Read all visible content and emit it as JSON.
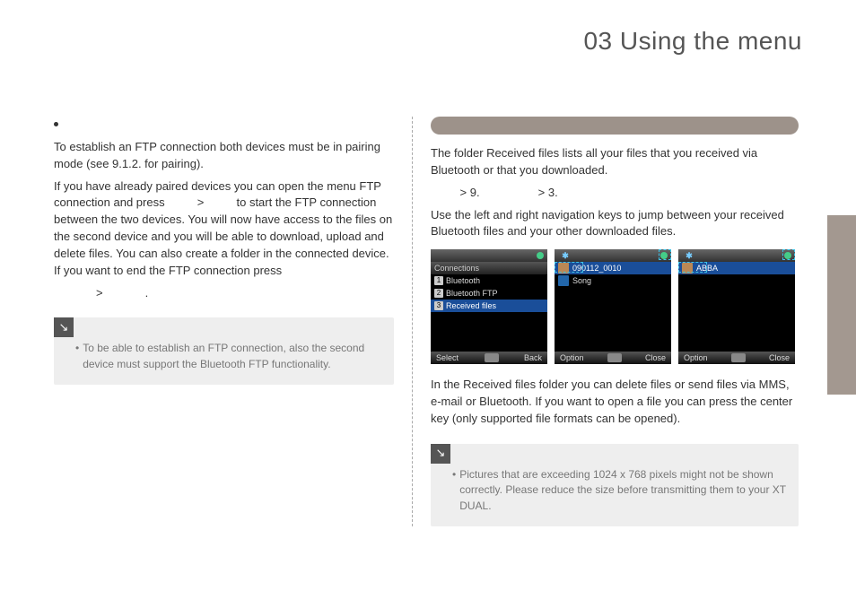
{
  "page": {
    "title": "03 Using the menu"
  },
  "left": {
    "p1": "To establish an FTP connection both devices must be in pairing mode (see 9.1.2. for pairing).",
    "p2a": "If you have already paired devices you can open the menu FTP connection and press ",
    "gt": " > ",
    "p2b": " to start the FTP connection between the two devices. You will now have access to the files on the second device and you will be able to download, upload and delete files. You can also create a folder in the connected device. If you want to end the FTP connection press",
    "p3_gt": " > ",
    "p3_end": ".",
    "note": "To be able to establish an FTP connection, also the second device must support the Bluetooth FTP functionality."
  },
  "right": {
    "p1": "The folder Received files lists all your files that you received via Bluetooth or that you downloaded.",
    "path_a": " > 9. ",
    "path_b": " > 3.",
    "p2": "Use the left and right navigation keys to jump between your received Bluetooth files and your other downloaded files.",
    "p3": "In the Received files folder you can delete files or send files via MMS, e-mail or Bluetooth. If you want to open a file you can press the center key (only supported file formats can be opened).",
    "note": "Pictures that are exceeding 1024 x 768 pixels might not be shown correctly. Please reduce the size before transmitting them to your XT DUAL."
  },
  "screens": {
    "s1": {
      "title": "Connections",
      "r1": "Bluetooth",
      "r2": "Bluetooth FTP",
      "r3": "Received files",
      "softL": "Select",
      "softR": "Back"
    },
    "s2": {
      "sel": "090112_0010",
      "r1": "Song",
      "softL": "Option",
      "softR": "Close"
    },
    "s3": {
      "sel": "ABBA",
      "softL": "Option",
      "softR": "Close"
    }
  },
  "icons": {
    "arrow": "↘",
    "bullet": "•"
  }
}
